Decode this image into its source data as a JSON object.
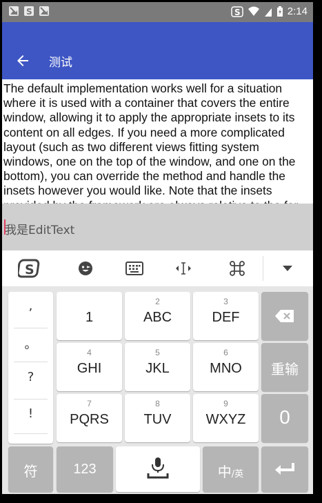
{
  "status_bar": {
    "time": "2:14"
  },
  "app_bar": {
    "title": "测试"
  },
  "content": {
    "text": "The default implementation works well for a situation where it is used with a container that covers the entire window, allowing it to apply the appropriate insets to its content on all edges. If you need a more complicated layout (such as two different views fitting system windows, one on the top of the window, and one on the bottom), you can override the method and handle the insets however you would like. Note that the insets provided by the framework are always relative to the far"
  },
  "edit_text": {
    "placeholder": "我是EditText"
  },
  "keyboard": {
    "punctuation": [
      ",",
      "。",
      "?",
      "!"
    ],
    "keys": [
      {
        "num": "",
        "label": "1"
      },
      {
        "num": "2",
        "label": "ABC"
      },
      {
        "num": "3",
        "label": "DEF"
      },
      {
        "num": "4",
        "label": "GHI"
      },
      {
        "num": "5",
        "label": "JKL"
      },
      {
        "num": "6",
        "label": "MNO"
      },
      {
        "num": "7",
        "label": "PQRS"
      },
      {
        "num": "8",
        "label": "TUV"
      },
      {
        "num": "9",
        "label": "WXYZ"
      }
    ],
    "reenter_label": "重输",
    "zero_label": "0",
    "symbol_label": "符",
    "num123_label": "123",
    "lang_label_main": "中",
    "lang_label_sub": "/英"
  },
  "colors": {
    "app_bar": "#3e56c4",
    "status_bar": "#7a7a7a",
    "edit_bg": "#cfcfcf",
    "caret": "#e04060"
  }
}
